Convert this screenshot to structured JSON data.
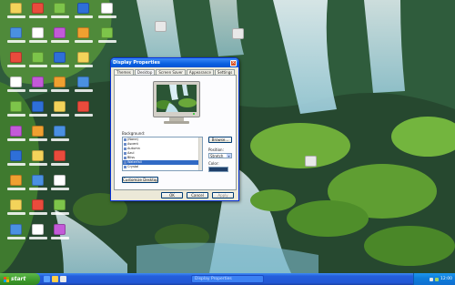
{
  "dialog": {
    "title": "Display Properties",
    "tabs": [
      {
        "label": "Themes",
        "active": false
      },
      {
        "label": "Desktop",
        "active": true
      },
      {
        "label": "Screen Saver",
        "active": false
      },
      {
        "label": "Appearance",
        "active": false
      },
      {
        "label": "Settings",
        "active": false
      }
    ],
    "background_label": "Background:",
    "backgrounds": [
      {
        "label": "(None)",
        "selected": false
      },
      {
        "label": "Ascent",
        "selected": false
      },
      {
        "label": "Autumn",
        "selected": false
      },
      {
        "label": "Azul",
        "selected": false
      },
      {
        "label": "Bliss",
        "selected": false
      },
      {
        "label": "Waterfall",
        "selected": true
      },
      {
        "label": "Crystal",
        "selected": false
      }
    ],
    "browse_label": "Browse...",
    "position_label": "Position:",
    "position_value": "Stretch",
    "color_label": "Color:",
    "color_value": "#1f3f6a",
    "customize_label": "Customize Desktop...",
    "ok_label": "OK",
    "cancel_label": "Cancel",
    "apply_label": "Apply"
  },
  "taskbar": {
    "start_label": "start",
    "task_label": "Display Properties",
    "clock": "12:00"
  },
  "colors": {
    "taskbar": "#245edb",
    "start": "#3c9a2c",
    "selection": "#316ac5",
    "title": "#0a5fe0"
  }
}
